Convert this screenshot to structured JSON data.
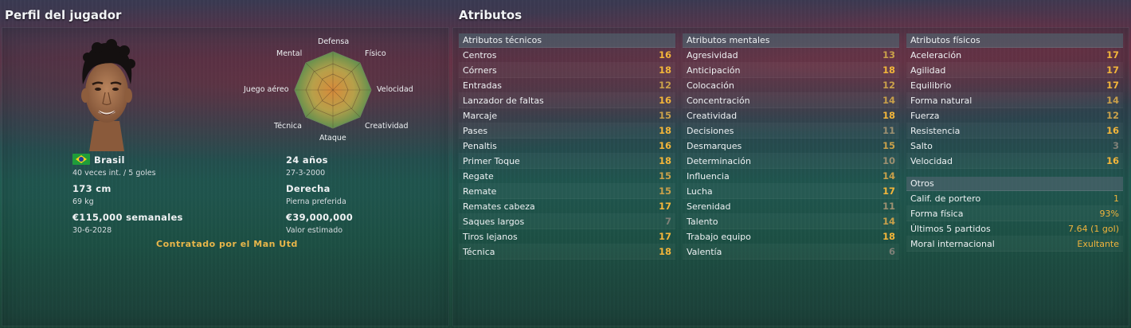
{
  "profile": {
    "title": "Perfil del jugador",
    "nationality": "Brasil",
    "caps": "40 veces int. / 5 goles",
    "height": "173 cm",
    "weight": "69 kg",
    "wage": "€115,000 semanales",
    "contract_end": "30-6-2028",
    "age": "24 años",
    "birthdate": "27-3-2000",
    "foot": "Derecha",
    "foot_label": "Pierna preferida",
    "value": "€39,000,000",
    "value_label": "Valor estimado",
    "contract_note": "Contratado por el Man Utd",
    "radar_labels": {
      "defensa": "Defensa",
      "fisico": "Físico",
      "velocidad": "Velocidad",
      "creatividad": "Creatividad",
      "ataque": "Ataque",
      "tecnica": "Técnica",
      "juego_aereo": "Juego aéreo",
      "mental": "Mental"
    }
  },
  "attributes": {
    "title": "Atributos",
    "technical": {
      "header": "Atributos técnicos",
      "rows": [
        {
          "label": "Centros",
          "value": "16"
        },
        {
          "label": "Córners",
          "value": "18"
        },
        {
          "label": "Entradas",
          "value": "12"
        },
        {
          "label": "Lanzador de faltas",
          "value": "16"
        },
        {
          "label": "Marcaje",
          "value": "15"
        },
        {
          "label": "Pases",
          "value": "18"
        },
        {
          "label": "Penaltis",
          "value": "16"
        },
        {
          "label": "Primer Toque",
          "value": "18"
        },
        {
          "label": "Regate",
          "value": "15"
        },
        {
          "label": "Remate",
          "value": "15"
        },
        {
          "label": "Remates cabeza",
          "value": "17"
        },
        {
          "label": "Saques largos",
          "value": "7"
        },
        {
          "label": "Tiros lejanos",
          "value": "17"
        },
        {
          "label": "Técnica",
          "value": "18"
        }
      ]
    },
    "mental": {
      "header": "Atributos mentales",
      "rows": [
        {
          "label": "Agresividad",
          "value": "13"
        },
        {
          "label": "Anticipación",
          "value": "18"
        },
        {
          "label": "Colocación",
          "value": "12"
        },
        {
          "label": "Concentración",
          "value": "14"
        },
        {
          "label": "Creatividad",
          "value": "18"
        },
        {
          "label": "Decisiones",
          "value": "11"
        },
        {
          "label": "Desmarques",
          "value": "15"
        },
        {
          "label": "Determinación",
          "value": "10"
        },
        {
          "label": "Influencia",
          "value": "14"
        },
        {
          "label": "Lucha",
          "value": "17"
        },
        {
          "label": "Serenidad",
          "value": "11"
        },
        {
          "label": "Talento",
          "value": "14"
        },
        {
          "label": "Trabajo equipo",
          "value": "18"
        },
        {
          "label": "Valentía",
          "value": "6"
        }
      ]
    },
    "physical": {
      "header": "Atributos físicos",
      "rows": [
        {
          "label": "Aceleración",
          "value": "17"
        },
        {
          "label": "Agilidad",
          "value": "17"
        },
        {
          "label": "Equilibrio",
          "value": "17"
        },
        {
          "label": "Forma natural",
          "value": "14"
        },
        {
          "label": "Fuerza",
          "value": "12"
        },
        {
          "label": "Resistencia",
          "value": "16"
        },
        {
          "label": "Salto",
          "value": "3"
        },
        {
          "label": "Velocidad",
          "value": "16"
        }
      ]
    },
    "other": {
      "header": "Otros",
      "rows": [
        {
          "label": "Calif. de portero",
          "value": "1"
        },
        {
          "label": "Forma física",
          "value": "93%"
        },
        {
          "label": "Últimos 5 partidos",
          "value": "7.64 (1 gol)"
        },
        {
          "label": "Moral internacional",
          "value": "Exultante"
        }
      ]
    }
  }
}
